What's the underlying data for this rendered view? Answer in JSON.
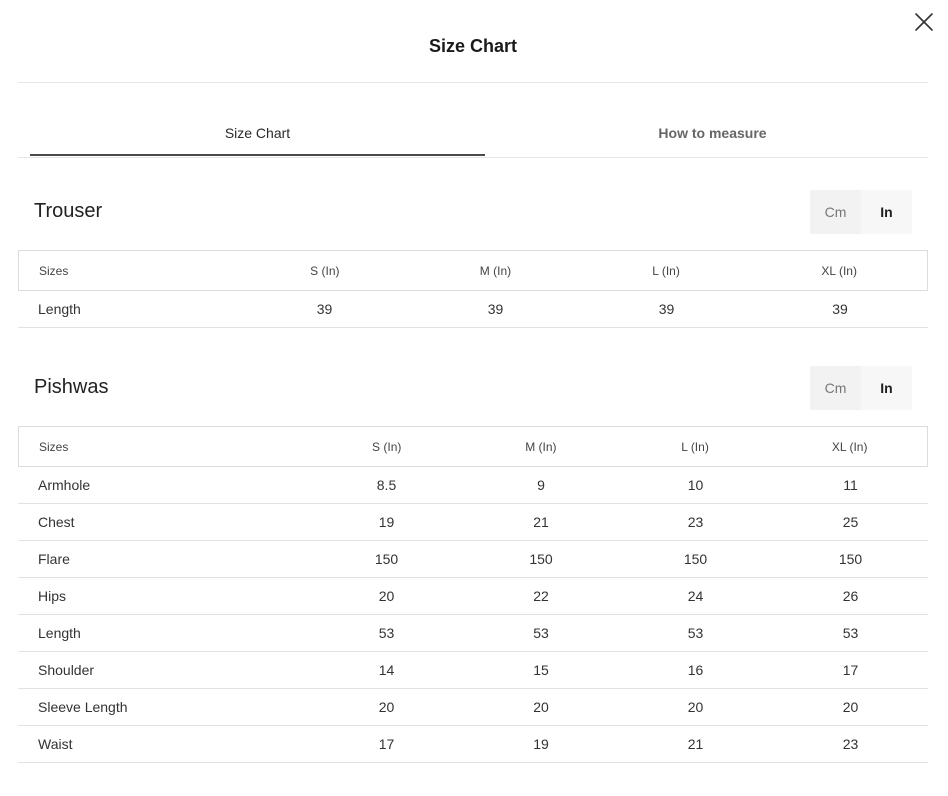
{
  "modal": {
    "title": "Size Chart"
  },
  "tabs": [
    {
      "label": "Size Chart"
    },
    {
      "label": "How to measure"
    }
  ],
  "trouser": {
    "title": "Trouser",
    "units": {
      "cm": "Cm",
      "in": "In"
    },
    "headers": [
      "Sizes",
      "S (In)",
      "M (In)",
      "L (In)",
      "XL (In)"
    ],
    "rows": [
      [
        "Length",
        "39",
        "39",
        "39",
        "39"
      ]
    ]
  },
  "pishwas": {
    "title": "Pishwas",
    "units": {
      "cm": "Cm",
      "in": "In"
    },
    "headers": [
      "Sizes",
      "S (In)",
      "M (In)",
      "L (In)",
      "XL (In)"
    ],
    "rows": [
      [
        "Armhole",
        "8.5",
        "9",
        "10",
        "11"
      ],
      [
        "Chest",
        "19",
        "21",
        "23",
        "25"
      ],
      [
        "Flare",
        "150",
        "150",
        "150",
        "150"
      ],
      [
        "Hips",
        "20",
        "22",
        "24",
        "26"
      ],
      [
        "Length",
        "53",
        "53",
        "53",
        "53"
      ],
      [
        "Shoulder",
        "14",
        "15",
        "16",
        "17"
      ],
      [
        "Sleeve Length",
        "20",
        "20",
        "20",
        "20"
      ],
      [
        "Waist",
        "17",
        "19",
        "21",
        "23"
      ]
    ]
  }
}
